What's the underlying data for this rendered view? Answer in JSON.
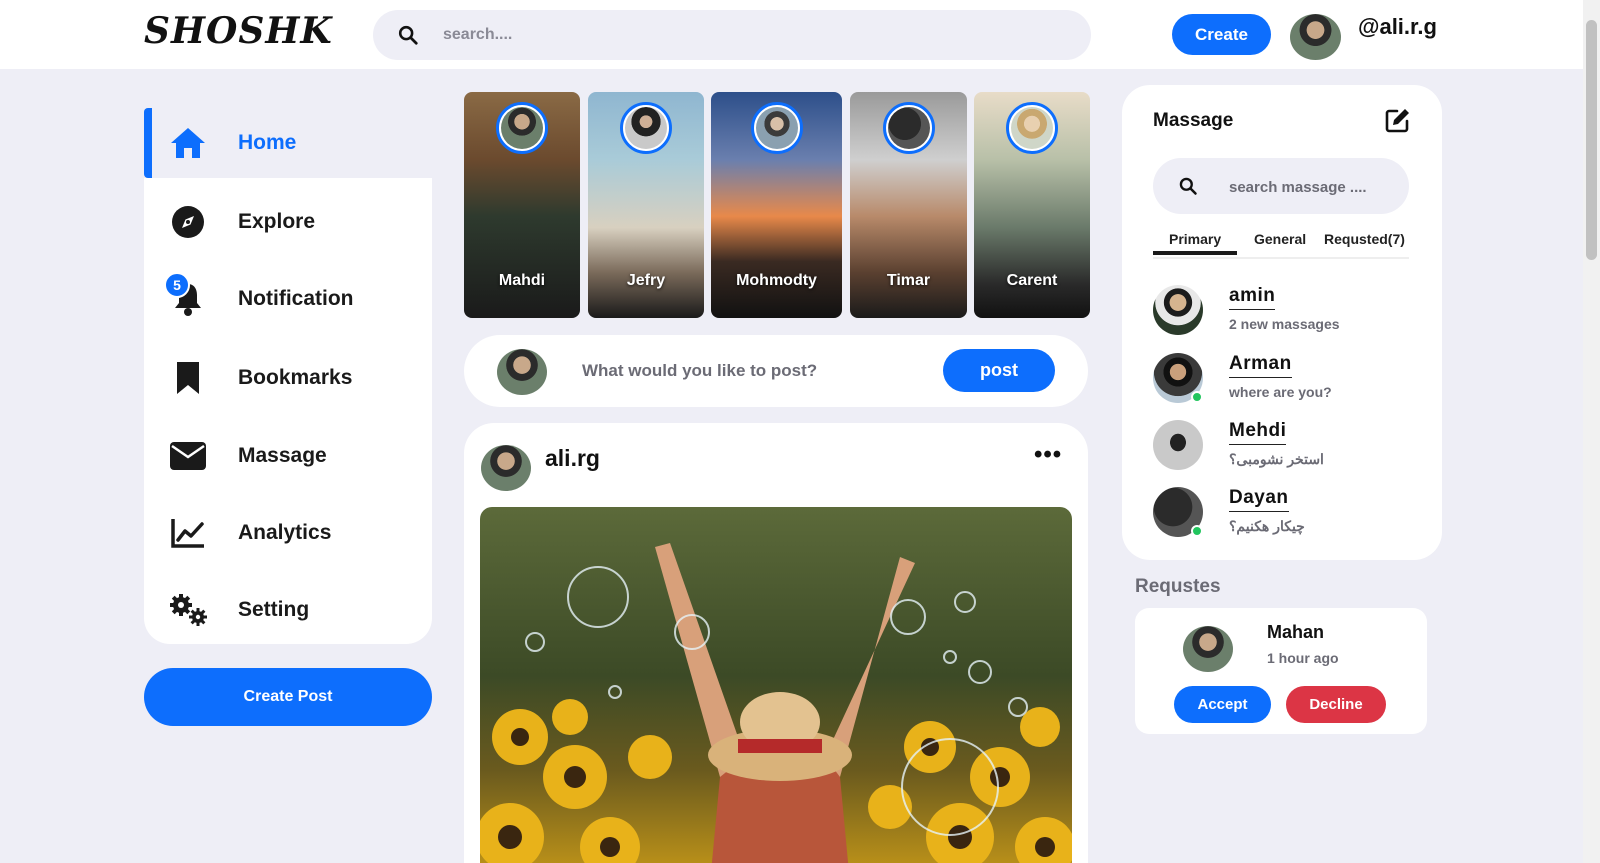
{
  "header": {
    "logo": "SHOSHK",
    "search_placeholder": "search....",
    "create_label": "Create",
    "username": "@ali.r.g"
  },
  "sidebar": {
    "items": [
      {
        "label": "Home",
        "icon": "home-icon",
        "active": true
      },
      {
        "label": "Explore",
        "icon": "compass-icon"
      },
      {
        "label": "Notification",
        "icon": "bell-icon",
        "badge": "5"
      },
      {
        "label": "Bookmarks",
        "icon": "bookmark-icon"
      },
      {
        "label": "Massage",
        "icon": "envelope-icon"
      },
      {
        "label": "Analytics",
        "icon": "chart-line-icon"
      },
      {
        "label": "Setting",
        "icon": "gears-icon"
      }
    ],
    "create_post_label": "Create Post"
  },
  "stories": [
    {
      "name": "Mahdi"
    },
    {
      "name": "Jefry"
    },
    {
      "name": "Mohmodty"
    },
    {
      "name": "Timar"
    },
    {
      "name": "Carent"
    }
  ],
  "composer": {
    "placeholder": "What would you like to post?",
    "post_label": "post"
  },
  "post": {
    "username": "ali.rg",
    "more": "•••"
  },
  "messages": {
    "title": "Massage",
    "search_placeholder": "search massage ....",
    "tabs": [
      "Primary",
      "General",
      "Requsted(7)"
    ],
    "contacts": [
      {
        "name": "amin",
        "preview": "2 new massages",
        "online": false
      },
      {
        "name": "Arman",
        "preview": "where are you?",
        "online": true
      },
      {
        "name": "Mehdi",
        "preview": "استخر نشومبی؟",
        "online": false
      },
      {
        "name": "Dayan",
        "preview": "چیکار هکنیم؟",
        "online": true
      }
    ]
  },
  "requests": {
    "title": "Requstes",
    "name": "Mahan",
    "time": "1 hour ago",
    "accept_label": "Accept",
    "decline_label": "Decline"
  },
  "colors": {
    "accent": "#0d6efd",
    "danger": "#dc3545",
    "background": "#eeeef6",
    "online": "#22c55e"
  }
}
